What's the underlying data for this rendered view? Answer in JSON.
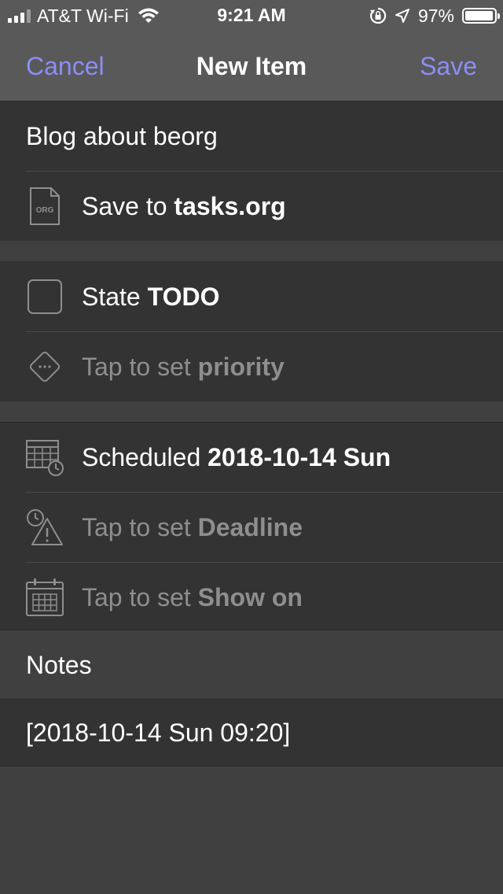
{
  "status": {
    "carrier": "AT&T Wi-Fi",
    "time": "9:21 AM",
    "battery": "97%",
    "battery_level": 0.97
  },
  "nav": {
    "cancel": "Cancel",
    "title": "New Item",
    "save": "Save"
  },
  "item": {
    "title": "Blog about beorg",
    "file_icon_label": "ORG",
    "save_prefix": "Save to",
    "save_file": "tasks.org"
  },
  "state": {
    "prefix": "State",
    "value": "TODO",
    "priority_prefix": "Tap to set",
    "priority_value": "priority"
  },
  "dates": {
    "scheduled_prefix": "Scheduled",
    "scheduled_value": "2018-10-14 Sun",
    "deadline_prefix": "Tap to set",
    "deadline_value": "Deadline",
    "showon_prefix": "Tap to set",
    "showon_value": "Show on"
  },
  "notes": {
    "header": "Notes",
    "content": "[2018-10-14 Sun 09:20]"
  },
  "colors": {
    "accent": "#8b8ef5",
    "background": "#404040",
    "cell": "#333333",
    "bar": "#595959"
  }
}
